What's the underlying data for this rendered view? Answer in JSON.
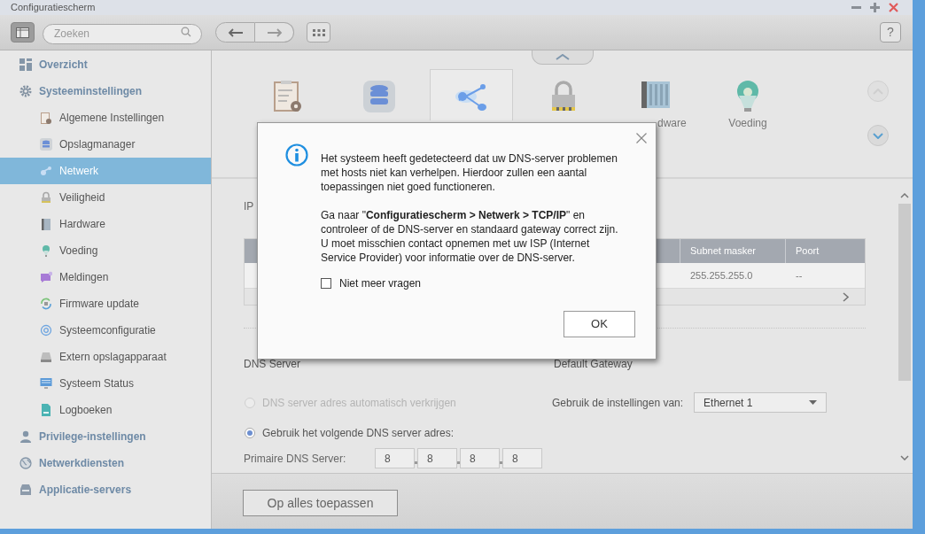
{
  "window": {
    "title": "Configuratiescherm"
  },
  "toolbar": {
    "search": {
      "placeholder": "Zoeken"
    },
    "help": "?"
  },
  "sidebar": {
    "items": [
      {
        "label": "Overzicht",
        "selected": false
      },
      {
        "label": "Systeeminstellingen",
        "selected": false,
        "children": [
          {
            "label": "Algemene Instellingen",
            "selected": false
          },
          {
            "label": "Opslagmanager",
            "selected": false
          },
          {
            "label": "Netwerk",
            "selected": true
          },
          {
            "label": "Veiligheid",
            "selected": false
          },
          {
            "label": "Hardware",
            "selected": false
          },
          {
            "label": "Voeding",
            "selected": false
          },
          {
            "label": "Meldingen",
            "selected": false
          },
          {
            "label": "Firmware update",
            "selected": false
          },
          {
            "label": "Systeemconfiguratie",
            "selected": false
          },
          {
            "label": "Extern opslagapparaat",
            "selected": false
          },
          {
            "label": "Systeem Status",
            "selected": false
          },
          {
            "label": "Logboeken",
            "selected": false
          }
        ]
      },
      {
        "label": "Privilege-instellingen",
        "selected": false
      },
      {
        "label": "Netwerkdiensten",
        "selected": false
      },
      {
        "label": "Applicatie-servers",
        "selected": false
      }
    ]
  },
  "category_tiles": [
    {
      "selected": false
    },
    {
      "selected": false
    },
    {
      "selected": true
    },
    {
      "selected": false
    },
    {
      "label": "dware",
      "selected": false,
      "clipped_left": true
    },
    {
      "label": "Voeding",
      "selected": false
    }
  ],
  "form": {
    "section_label": "IP",
    "table": {
      "columns": [
        "Subnet masker",
        "Poort"
      ],
      "rows": [
        [
          "255.255.255.0",
          "--"
        ]
      ]
    },
    "dns": {
      "title": "DNS Server",
      "options": [
        {
          "label": "DNS server adres automatisch verkrijgen",
          "selected": false,
          "disabled": true
        },
        {
          "label": "Gebruik het volgende DNS server adres:",
          "selected": true,
          "disabled": false
        }
      ],
      "primary": {
        "label": "Primaire DNS Server:",
        "octets": [
          "8",
          "8",
          "8",
          "8"
        ]
      }
    },
    "gateway": {
      "title": "Default Gateway",
      "label": "Gebruik de instellingen van:",
      "value": "Ethernet 1"
    }
  },
  "apply_button": "Op alles toepassen",
  "dialog": {
    "paragraphs": [
      "Het systeem heeft gedetecteerd dat uw DNS-server problemen met hosts niet kan verhelpen. Hierdoor zullen een aantal toepassingen niet goed functioneren.",
      "Ga naar \"**Configuratiescherm > Netwerk > TCP/IP**\" en controleer of de DNS-server en standaard gateway correct zijn. U moet misschien contact opnemen met uw ISP (Internet Service Provider) voor informatie over de DNS-server."
    ],
    "checkbox": {
      "label": "Niet meer vragen",
      "checked": false
    },
    "ok": "OK"
  }
}
